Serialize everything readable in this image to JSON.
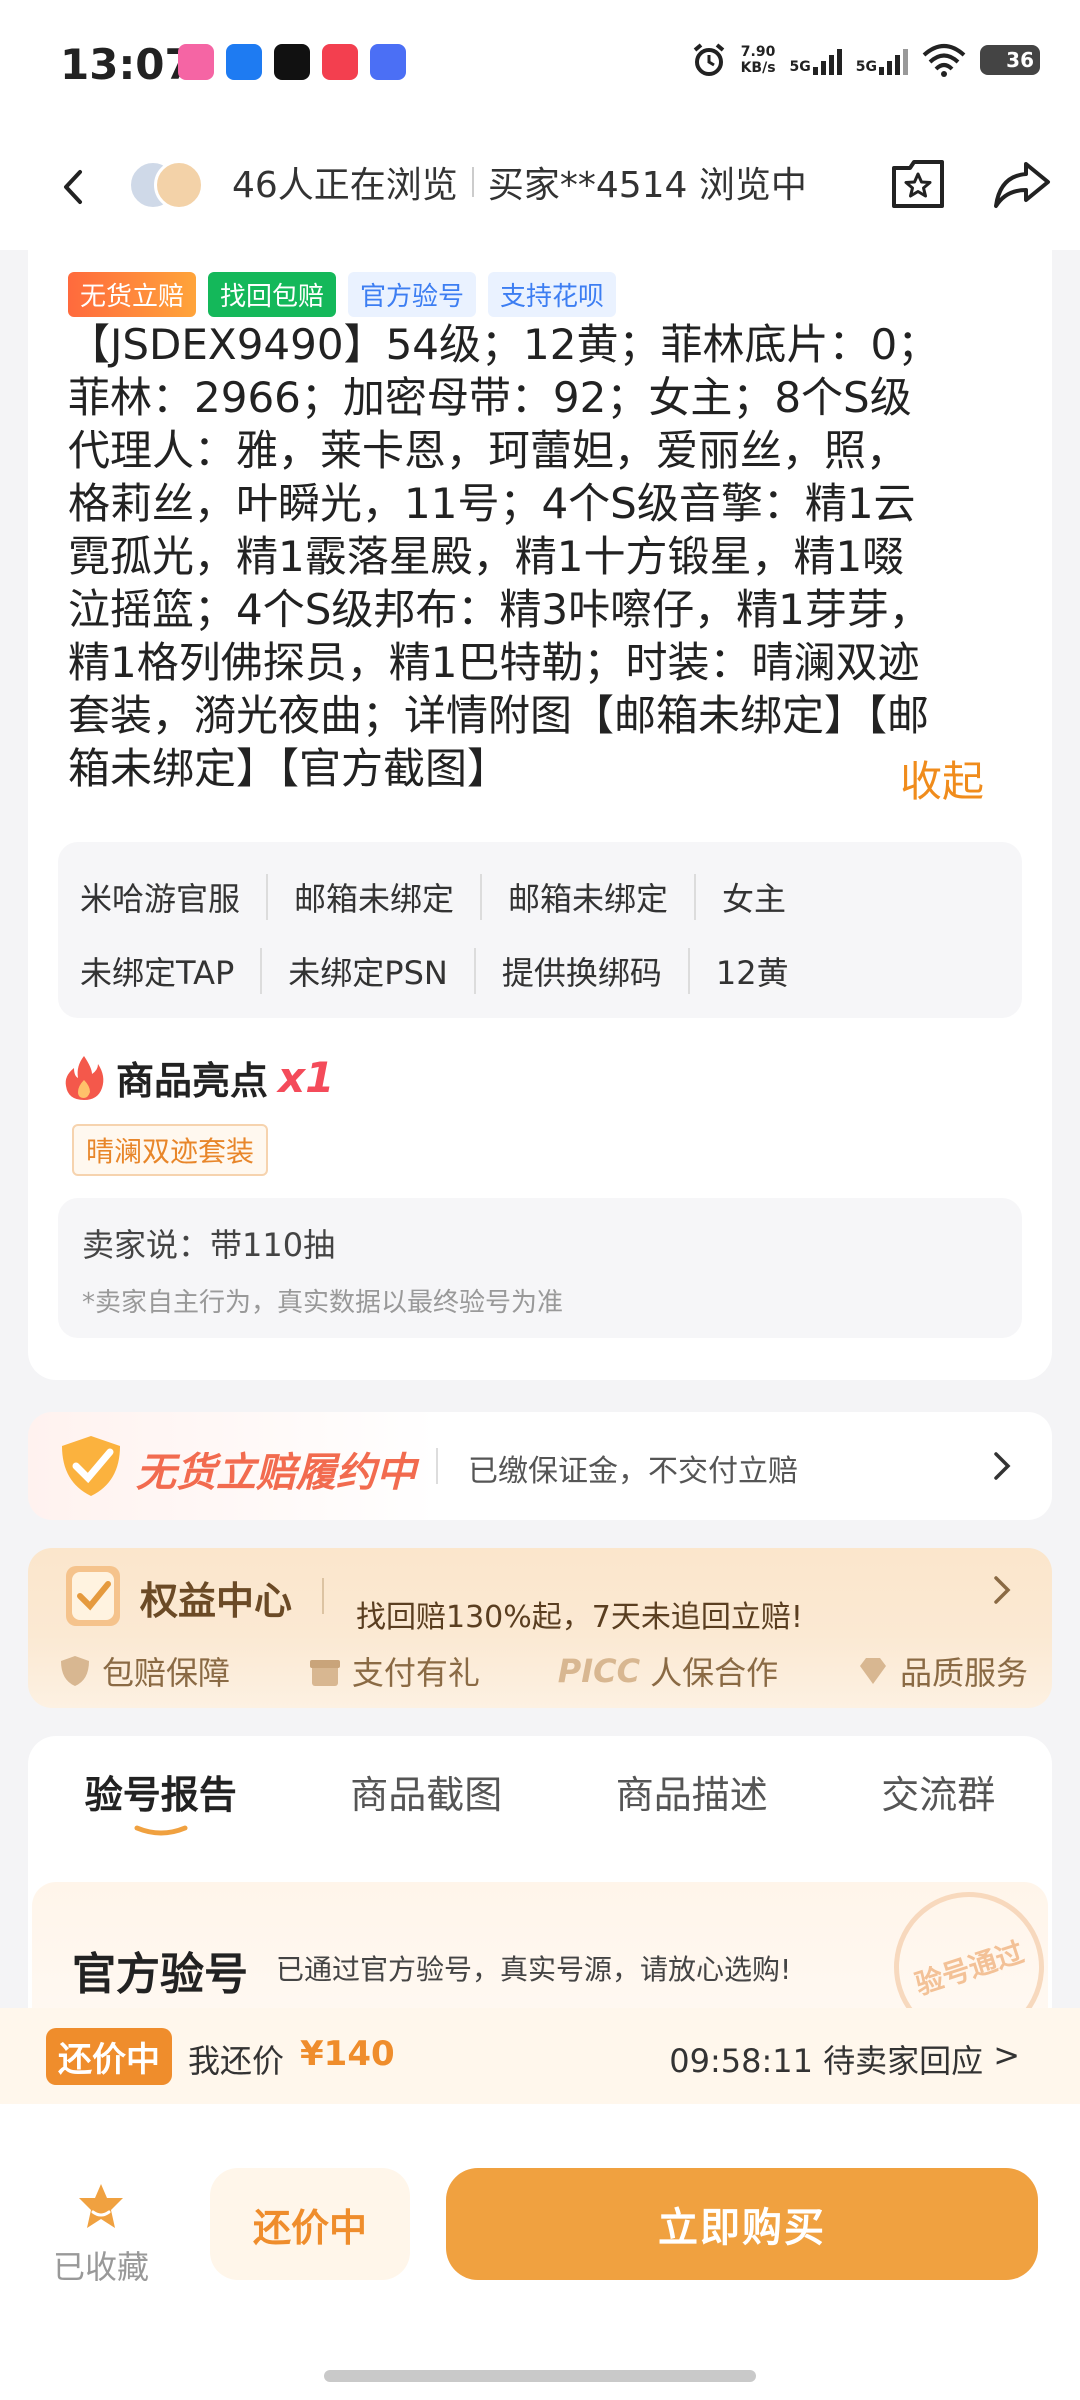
{
  "status_bar": {
    "time": "13:07",
    "net_speed_value": "7.90",
    "net_speed_unit": "KB/s",
    "sig1": "5G",
    "sig2": "5G",
    "battery": "36",
    "app_colors": [
      "#f565a4",
      "#1e7bf2",
      "#111111",
      "#f33f4f",
      "#4b6ff5"
    ]
  },
  "header": {
    "viewers": "46人正在浏览",
    "buyer": "买家**4514 浏览中",
    "icons": [
      "back-arrow-icon",
      "favorite-star-folder-icon",
      "share-icon"
    ]
  },
  "product": {
    "badges": [
      "无货立赔",
      "找回包赔",
      "官方验号",
      "支持花呗"
    ],
    "description_lines": [
      "【JSDEX9490】54级；12黄；菲林底片：0；",
      "菲林：2966；加密母带：92；女主；8个S级",
      "代理人：雅，莱卡恩，珂蕾妲，爱丽丝，照，",
      "格莉丝，叶瞬光，11号；4个S级音擎：精1云",
      "霓孤光，精1霰落星殿，精1十方锻星，精1啜",
      "泣摇篮；4个S级邦布：精3咔嚓仔，精1芽芽，",
      "精1格列佛探员，精1巴特勒；时装：晴澜双迹",
      "套装，漪光夜曲；详情附图【邮箱未绑定】【邮",
      "箱未绑定】【官方截图】"
    ],
    "collapse_label": "收起",
    "tags_row1": [
      "米哈游官服",
      "邮箱未绑定",
      "邮箱未绑定",
      "女主"
    ],
    "tags_row2": [
      "未绑定TAP",
      "未绑定PSN",
      "提供换绑码",
      "12黄"
    ],
    "highlight_title": "商品亮点",
    "highlight_count": "x1",
    "highlight_tag": "晴澜双迹套装",
    "seller_says": "卖家说：带110抽",
    "seller_note": "*卖家自主行为，真实数据以最终验号为准"
  },
  "guarantee": {
    "title": "无货立赔履约中",
    "subtitle": "已缴保证金，不交付立赔"
  },
  "rights": {
    "title": "权益中心",
    "subtitle": "找回赔130%起，7天未追回立赔!",
    "features": [
      "包赔保障",
      "支付有礼",
      "人保合作",
      "品质服务"
    ],
    "picc_label": "PICC"
  },
  "tabs": {
    "items": [
      "验号报告",
      "商品截图",
      "商品描述",
      "交流群"
    ],
    "active": 0
  },
  "official_check": {
    "title": "官方验号",
    "subtitle": "已通过官方验号，真实号源，请放心选购!",
    "stamp": "验号通过"
  },
  "bargain": {
    "badge": "还价中",
    "label": "我还价",
    "price": "¥140",
    "countdown": "09:58:11 待卖家回应",
    "chevron": ">"
  },
  "bottom": {
    "favorite_label": "已收藏",
    "bargain_button": "还价中",
    "buy_button": "立即购买"
  },
  "colors": {
    "accent_orange": "#f0a140",
    "price_orange": "#ef8d2c",
    "highlight_red": "#f44b5a"
  }
}
